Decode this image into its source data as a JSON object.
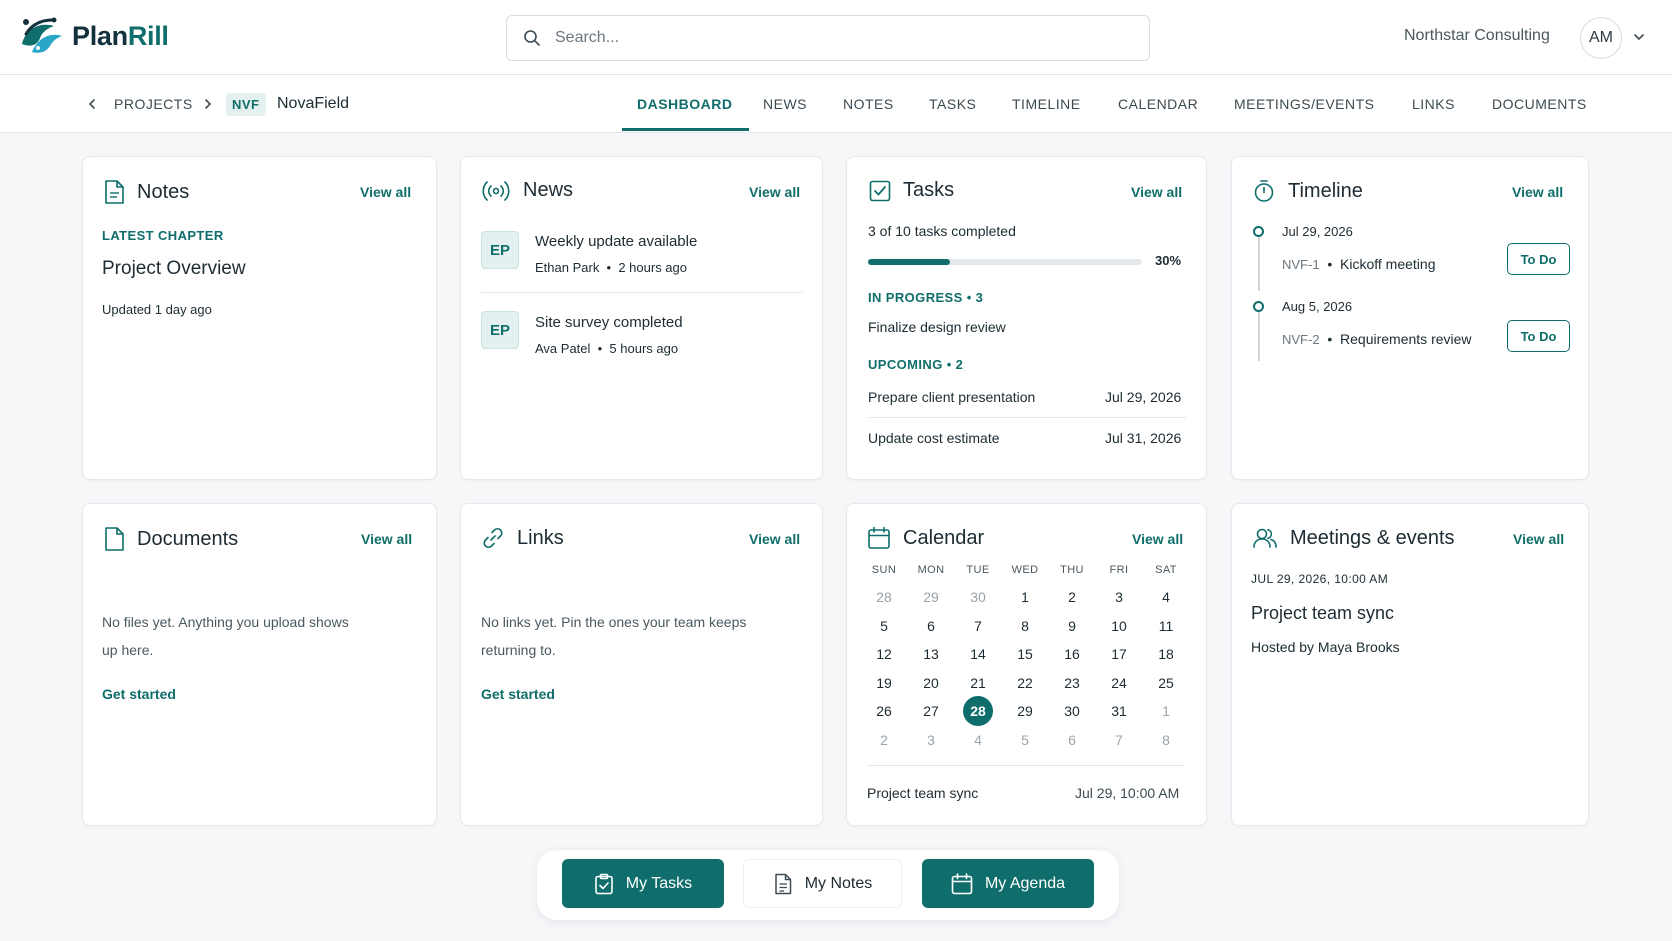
{
  "app": {
    "logo_prefix": "Plan",
    "logo_suffix": "Rill",
    "org_name": "Northstar Consulting",
    "avatar_initials": "AM"
  },
  "search": {
    "placeholder": "Search..."
  },
  "breadcrumb": {
    "projects": "PROJECTS",
    "code": "NVF",
    "name": "NovaField"
  },
  "tabs": [
    "DASHBOARD",
    "NEWS",
    "NOTES",
    "TASKS",
    "TIMELINE",
    "CALENDAR",
    "MEETINGS/EVENTS",
    "LINKS",
    "DOCUMENTS"
  ],
  "view_all": "View all",
  "notes": {
    "title": "Notes",
    "label": "LATEST CHAPTER",
    "chapter": "Project Overview",
    "updated": "Updated 1 day ago"
  },
  "news": {
    "title": "News",
    "items": [
      {
        "initials": "EP",
        "title": "Weekly update available",
        "author": "Ethan Park",
        "time": "2 hours ago"
      },
      {
        "initials": "EP",
        "title": "Site survey completed",
        "author": "Ava Patel",
        "time": "5 hours ago"
      }
    ]
  },
  "tasks": {
    "title": "Tasks",
    "summary": "3 of 10 tasks completed",
    "progress_percent": 30,
    "progress_label": "30%",
    "in_progress_label": "IN PROGRESS • 3",
    "in_progress_item": "Finalize design review",
    "upcoming_label": "UPCOMING • 2",
    "upcoming": [
      {
        "name": "Prepare client presentation",
        "date": "Jul 29, 2026"
      },
      {
        "name": "Update cost estimate",
        "date": "Jul 31, 2026"
      }
    ]
  },
  "timeline": {
    "title": "Timeline",
    "items": [
      {
        "date": "Jul 29, 2026",
        "code": "NVF-1",
        "name": "Kickoff meeting",
        "status": "To Do"
      },
      {
        "date": "Aug 5, 2026",
        "code": "NVF-2",
        "name": "Requirements review",
        "status": "To Do"
      }
    ]
  },
  "documents": {
    "title": "Documents",
    "empty_line1": "No files yet. Anything you upload shows",
    "empty_line2": "up here.",
    "cta": "Get started"
  },
  "links": {
    "title": "Links",
    "empty_line1": "No links yet. Pin the ones your team keeps",
    "empty_line2": "returning to.",
    "cta": "Get started"
  },
  "calendar": {
    "title": "Calendar",
    "weekdays": [
      "SUN",
      "MON",
      "TUE",
      "WED",
      "THU",
      "FRI",
      "SAT"
    ],
    "weeks": [
      [
        "28",
        "29",
        "30",
        "1",
        "2",
        "3",
        "4"
      ],
      [
        "5",
        "6",
        "7",
        "8",
        "9",
        "10",
        "11"
      ],
      [
        "12",
        "13",
        "14",
        "15",
        "16",
        "17",
        "18"
      ],
      [
        "19",
        "20",
        "21",
        "22",
        "23",
        "24",
        "25"
      ],
      [
        "26",
        "27",
        "28",
        "29",
        "30",
        "31",
        "1"
      ],
      [
        "2",
        "3",
        "4",
        "5",
        "6",
        "7",
        "8"
      ]
    ],
    "today": "28",
    "event_name": "Project team sync",
    "event_time": "Jul 29, 10:00 AM"
  },
  "meetings": {
    "title": "Meetings & events",
    "datetime": "JUL 29, 2026, 10:00 AM",
    "name": "Project team sync",
    "host": "Hosted by Maya Brooks"
  },
  "dock": {
    "my_tasks": "My Tasks",
    "my_notes": "My Notes",
    "my_agenda": "My Agenda"
  },
  "colors": {
    "accent": "#0f6e6b",
    "accent_light": "#e5f1f0",
    "background": "#f6f7f9"
  }
}
